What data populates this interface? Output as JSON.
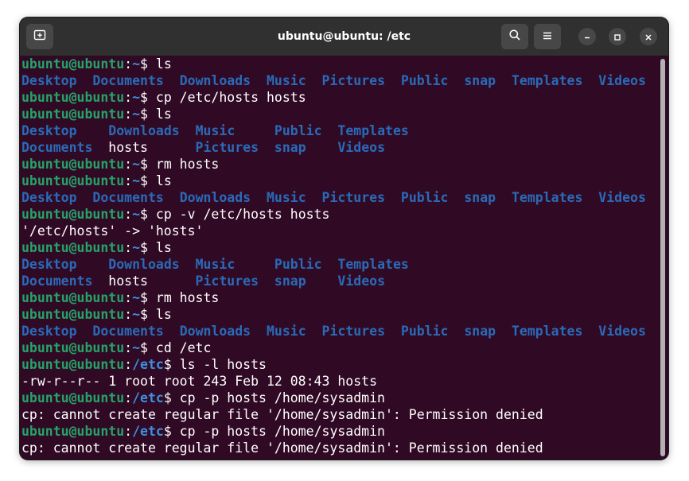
{
  "window": {
    "title": "ubuntu@ubuntu: /etc",
    "icons": {
      "new_tab": "new-tab-icon",
      "search": "search-icon",
      "menu": "hamburger-menu-icon",
      "minimize": "minimize-icon",
      "maximize": "maximize-icon",
      "close": "close-icon"
    }
  },
  "colors": {
    "background": "#300a24",
    "user_host": "#26a269",
    "path": "#3d8fe0",
    "directory": "#2a6ab8",
    "text": "#ffffff",
    "titlebar": "#303030"
  },
  "terminal": {
    "lines": [
      [
        {
          "t": "ubuntu@ubuntu",
          "c": "usr"
        },
        {
          "t": ":"
        },
        {
          "t": "~",
          "c": "path"
        },
        {
          "t": "$ ls"
        }
      ],
      [
        {
          "t": "Desktop",
          "c": "dir"
        },
        {
          "t": "  "
        },
        {
          "t": "Documents",
          "c": "dir"
        },
        {
          "t": "  "
        },
        {
          "t": "Downloads",
          "c": "dir"
        },
        {
          "t": "  "
        },
        {
          "t": "Music",
          "c": "dir"
        },
        {
          "t": "  "
        },
        {
          "t": "Pictures",
          "c": "dir"
        },
        {
          "t": "  "
        },
        {
          "t": "Public",
          "c": "dir"
        },
        {
          "t": "  "
        },
        {
          "t": "snap",
          "c": "dir"
        },
        {
          "t": "  "
        },
        {
          "t": "Templates",
          "c": "dir"
        },
        {
          "t": "  "
        },
        {
          "t": "Videos",
          "c": "dir"
        }
      ],
      [
        {
          "t": "ubuntu@ubuntu",
          "c": "usr"
        },
        {
          "t": ":"
        },
        {
          "t": "~",
          "c": "path"
        },
        {
          "t": "$ cp /etc/hosts hosts"
        }
      ],
      [
        {
          "t": "ubuntu@ubuntu",
          "c": "usr"
        },
        {
          "t": ":"
        },
        {
          "t": "~",
          "c": "path"
        },
        {
          "t": "$ ls"
        }
      ],
      [
        {
          "t": "Desktop",
          "c": "dir"
        },
        {
          "t": "    "
        },
        {
          "t": "Downloads",
          "c": "dir"
        },
        {
          "t": "  "
        },
        {
          "t": "Music",
          "c": "dir"
        },
        {
          "t": "     "
        },
        {
          "t": "Public",
          "c": "dir"
        },
        {
          "t": "  "
        },
        {
          "t": "Templates",
          "c": "dir"
        }
      ],
      [
        {
          "t": "Documents",
          "c": "dir"
        },
        {
          "t": "  hosts      "
        },
        {
          "t": "Pictures",
          "c": "dir"
        },
        {
          "t": "  "
        },
        {
          "t": "snap",
          "c": "dir"
        },
        {
          "t": "    "
        },
        {
          "t": "Videos",
          "c": "dir"
        }
      ],
      [
        {
          "t": "ubuntu@ubuntu",
          "c": "usr"
        },
        {
          "t": ":"
        },
        {
          "t": "~",
          "c": "path"
        },
        {
          "t": "$ rm hosts"
        }
      ],
      [
        {
          "t": "ubuntu@ubuntu",
          "c": "usr"
        },
        {
          "t": ":"
        },
        {
          "t": "~",
          "c": "path"
        },
        {
          "t": "$ ls"
        }
      ],
      [
        {
          "t": "Desktop",
          "c": "dir"
        },
        {
          "t": "  "
        },
        {
          "t": "Documents",
          "c": "dir"
        },
        {
          "t": "  "
        },
        {
          "t": "Downloads",
          "c": "dir"
        },
        {
          "t": "  "
        },
        {
          "t": "Music",
          "c": "dir"
        },
        {
          "t": "  "
        },
        {
          "t": "Pictures",
          "c": "dir"
        },
        {
          "t": "  "
        },
        {
          "t": "Public",
          "c": "dir"
        },
        {
          "t": "  "
        },
        {
          "t": "snap",
          "c": "dir"
        },
        {
          "t": "  "
        },
        {
          "t": "Templates",
          "c": "dir"
        },
        {
          "t": "  "
        },
        {
          "t": "Videos",
          "c": "dir"
        }
      ],
      [
        {
          "t": "ubuntu@ubuntu",
          "c": "usr"
        },
        {
          "t": ":"
        },
        {
          "t": "~",
          "c": "path"
        },
        {
          "t": "$ cp -v /etc/hosts hosts"
        }
      ],
      [
        {
          "t": "'/etc/hosts' -> 'hosts'"
        }
      ],
      [
        {
          "t": "ubuntu@ubuntu",
          "c": "usr"
        },
        {
          "t": ":"
        },
        {
          "t": "~",
          "c": "path"
        },
        {
          "t": "$ ls"
        }
      ],
      [
        {
          "t": "Desktop",
          "c": "dir"
        },
        {
          "t": "    "
        },
        {
          "t": "Downloads",
          "c": "dir"
        },
        {
          "t": "  "
        },
        {
          "t": "Music",
          "c": "dir"
        },
        {
          "t": "     "
        },
        {
          "t": "Public",
          "c": "dir"
        },
        {
          "t": "  "
        },
        {
          "t": "Templates",
          "c": "dir"
        }
      ],
      [
        {
          "t": "Documents",
          "c": "dir"
        },
        {
          "t": "  hosts      "
        },
        {
          "t": "Pictures",
          "c": "dir"
        },
        {
          "t": "  "
        },
        {
          "t": "snap",
          "c": "dir"
        },
        {
          "t": "    "
        },
        {
          "t": "Videos",
          "c": "dir"
        }
      ],
      [
        {
          "t": "ubuntu@ubuntu",
          "c": "usr"
        },
        {
          "t": ":"
        },
        {
          "t": "~",
          "c": "path"
        },
        {
          "t": "$ rm hosts"
        }
      ],
      [
        {
          "t": "ubuntu@ubuntu",
          "c": "usr"
        },
        {
          "t": ":"
        },
        {
          "t": "~",
          "c": "path"
        },
        {
          "t": "$ ls"
        }
      ],
      [
        {
          "t": "Desktop",
          "c": "dir"
        },
        {
          "t": "  "
        },
        {
          "t": "Documents",
          "c": "dir"
        },
        {
          "t": "  "
        },
        {
          "t": "Downloads",
          "c": "dir"
        },
        {
          "t": "  "
        },
        {
          "t": "Music",
          "c": "dir"
        },
        {
          "t": "  "
        },
        {
          "t": "Pictures",
          "c": "dir"
        },
        {
          "t": "  "
        },
        {
          "t": "Public",
          "c": "dir"
        },
        {
          "t": "  "
        },
        {
          "t": "snap",
          "c": "dir"
        },
        {
          "t": "  "
        },
        {
          "t": "Templates",
          "c": "dir"
        },
        {
          "t": "  "
        },
        {
          "t": "Videos",
          "c": "dir"
        }
      ],
      [
        {
          "t": "ubuntu@ubuntu",
          "c": "usr"
        },
        {
          "t": ":"
        },
        {
          "t": "~",
          "c": "path"
        },
        {
          "t": "$ cd /etc"
        }
      ],
      [
        {
          "t": "ubuntu@ubuntu",
          "c": "usr"
        },
        {
          "t": ":"
        },
        {
          "t": "/etc",
          "c": "path"
        },
        {
          "t": "$ ls -l hosts"
        }
      ],
      [
        {
          "t": "-rw-r--r-- 1 root root 243 Feb 12 08:43 hosts"
        }
      ],
      [
        {
          "t": "ubuntu@ubuntu",
          "c": "usr"
        },
        {
          "t": ":"
        },
        {
          "t": "/etc",
          "c": "path"
        },
        {
          "t": "$ cp -p hosts /home/sysadmin"
        }
      ],
      [
        {
          "t": "cp: cannot create regular file '/home/sysadmin': Permission denied"
        }
      ],
      [
        {
          "t": "ubuntu@ubuntu",
          "c": "usr"
        },
        {
          "t": ":"
        },
        {
          "t": "/etc",
          "c": "path"
        },
        {
          "t": "$ cp -p hosts /home/sysadmin"
        }
      ],
      [
        {
          "t": "cp: cannot create regular file '/home/sysadmin': Permission denied"
        }
      ]
    ]
  }
}
